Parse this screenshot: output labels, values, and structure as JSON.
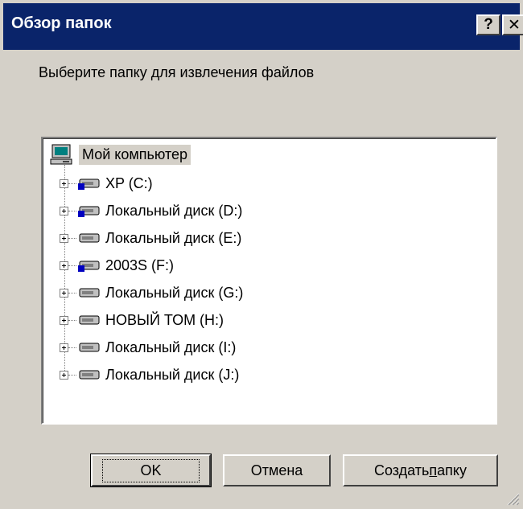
{
  "window": {
    "title": "Обзор папок",
    "help_label": "?",
    "close_label": "✕"
  },
  "prompt": "Выберите папку для извлечения файлов",
  "tree": {
    "root": {
      "label": "Мой компьютер",
      "icon": "my-computer-icon",
      "selected": true
    },
    "items": [
      {
        "label": "XP (C:)",
        "icon": "shared-drive-icon"
      },
      {
        "label": "Локальный диск (D:)",
        "icon": "shared-drive-icon"
      },
      {
        "label": "Локальный диск (E:)",
        "icon": "hard-drive-icon"
      },
      {
        "label": "2003S (F:)",
        "icon": "shared-drive-icon"
      },
      {
        "label": "Локальный диск (G:)",
        "icon": "hard-drive-icon"
      },
      {
        "label": "НОВЫЙ ТОМ (H:)",
        "icon": "hard-drive-icon"
      },
      {
        "label": "Локальный диск (I:)",
        "icon": "hard-drive-icon"
      },
      {
        "label": "Локальный диск (J:)",
        "icon": "hard-drive-icon"
      }
    ]
  },
  "buttons": {
    "ok": "OK",
    "cancel": "Отмена",
    "new_folder_prefix": "Создать ",
    "new_folder_accel": "п",
    "new_folder_suffix": "апку"
  },
  "colors": {
    "titlebar": "#0a246a",
    "face": "#d4d0c8",
    "selection": "#d4d0c8"
  }
}
